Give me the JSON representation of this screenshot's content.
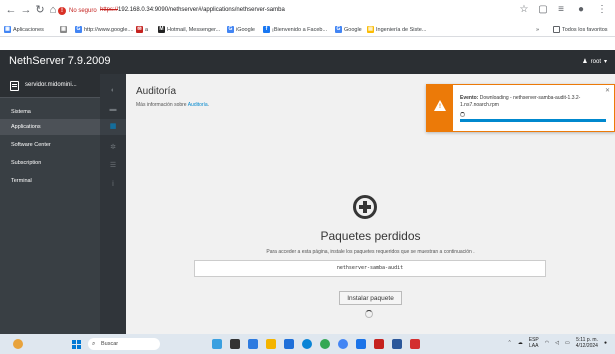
{
  "browser": {
    "security_label": "No seguro",
    "url_scheme": "https://",
    "url_rest": "192.168.0.34:9090/nethserver#/applications/nethserver-samba",
    "bookmarks": [
      {
        "label": "Aplicaciones",
        "icon": "apps-grid-icon"
      },
      {
        "label": "http://www.google....",
        "icon": "google-icon"
      },
      {
        "label": "a",
        "icon": "mail-icon"
      },
      {
        "label": "Hotmail, Messenger...",
        "icon": "hotmail-icon"
      },
      {
        "label": "iGoogle",
        "icon": "google-icon"
      },
      {
        "label": "¡Bienvenido a Faceb...",
        "icon": "facebook-icon"
      },
      {
        "label": "Google",
        "icon": "google-icon"
      },
      {
        "label": "Ingeniería de Siste...",
        "icon": "page-icon"
      }
    ],
    "more_bookmarks": "»",
    "all_favorites": "Todos los favoritos"
  },
  "app": {
    "brand": "NethServer 7.9.2009",
    "user": "root",
    "host": "servidor.midomini...",
    "nav": [
      "Sistema",
      "Applications",
      "Software Center",
      "Subscription",
      "Terminal"
    ],
    "active_nav": "Applications"
  },
  "page": {
    "title": "Auditoría",
    "subtitle_prefix": "Más información sobre",
    "subtitle_link": "Auditoría",
    "missing_title": "Paquetes perdidos",
    "missing_desc": "Para acceder a esta página, instale los paquetes requeridos que se muestran a continuación .",
    "package": "nethserver-samba-audit",
    "install_label": "Instalar paquete"
  },
  "toast": {
    "event_label": "Evento:",
    "event_text": "Downloading - nethserver-samba-audit-1.3.2-1.ns7.noarch.rpm",
    "progress": 1.0,
    "accent": "#ec7a08"
  },
  "taskbar": {
    "search_placeholder": "Buscar",
    "lang_top": "ESP",
    "lang_bottom": "LAA",
    "time": "5:11 p. m.",
    "date": "4/12/2024"
  }
}
